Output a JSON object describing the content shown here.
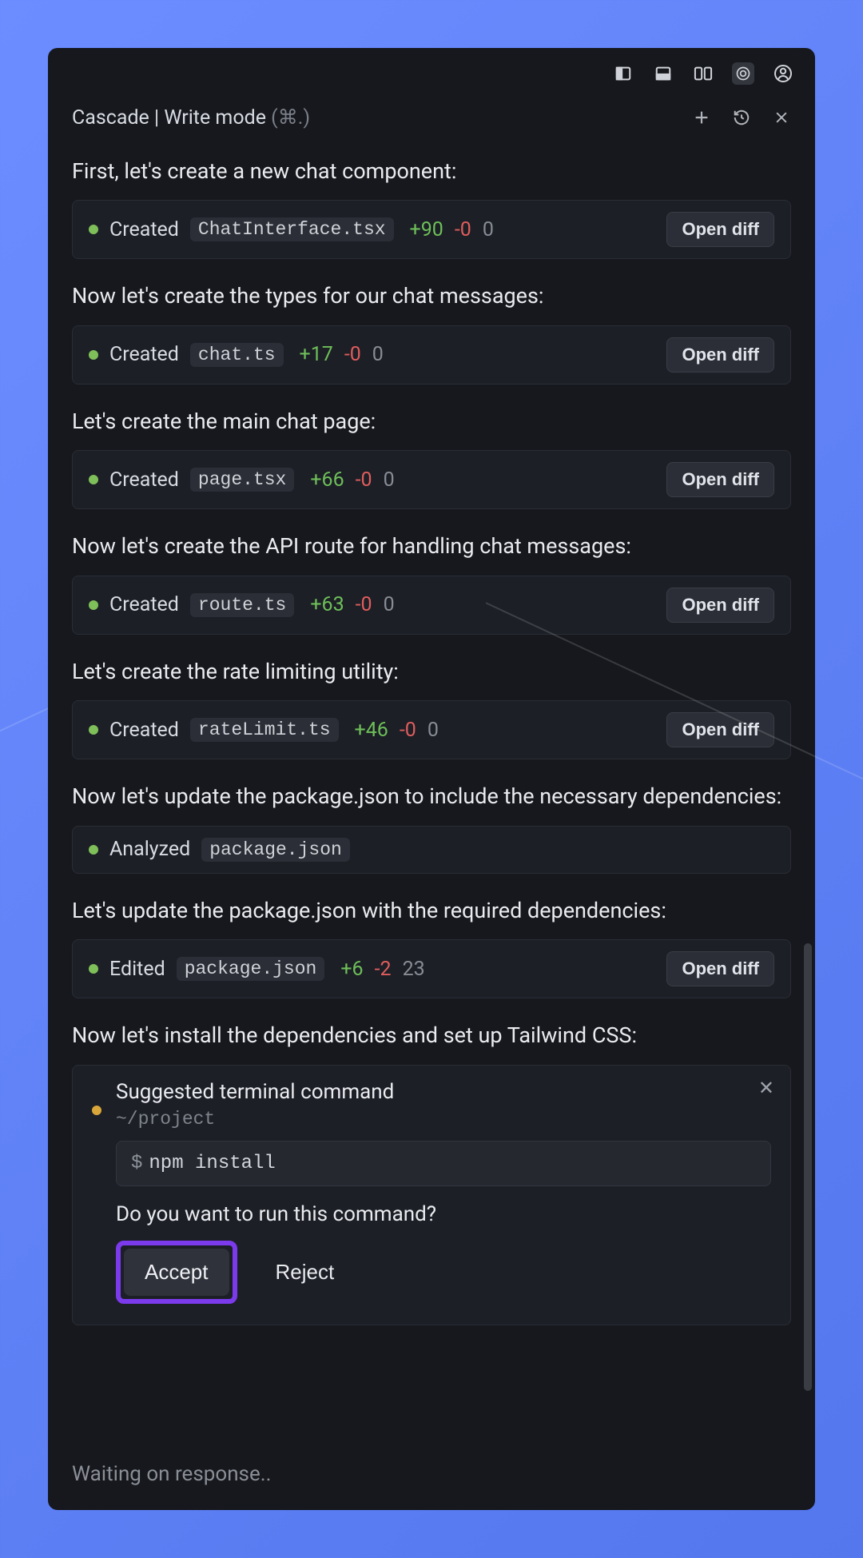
{
  "toolbar_icons": [
    "panel-left-icon",
    "panel-bottom-icon",
    "panel-split-icon",
    "windsurf-logo-icon",
    "account-icon"
  ],
  "header": {
    "title": "Cascade | Write mode",
    "shortcut": "(⌘.)",
    "icons": [
      "plus-icon",
      "history-icon",
      "close-icon"
    ]
  },
  "colors": {
    "add": "#6ebf59",
    "del": "#e05d5d",
    "neutral": "#888c94",
    "highlight": "#7c3aed"
  },
  "steps": [
    {
      "text": "First, let's create a new chat component:",
      "card": {
        "action": "Created",
        "file": "ChatInterface.tsx",
        "adds": "+90",
        "dels": "-0",
        "neutral": "0",
        "open": "Open diff"
      }
    },
    {
      "text": "Now let's create the types for our chat messages:",
      "card": {
        "action": "Created",
        "file": "chat.ts",
        "adds": "+17",
        "dels": "-0",
        "neutral": "0",
        "open": "Open diff"
      }
    },
    {
      "text": "Let's create the main chat page:",
      "card": {
        "action": "Created",
        "file": "page.tsx",
        "adds": "+66",
        "dels": "-0",
        "neutral": "0",
        "open": "Open diff"
      }
    },
    {
      "text": "Now let's create the API route for handling chat messages:",
      "card": {
        "action": "Created",
        "file": "route.ts",
        "adds": "+63",
        "dels": "-0",
        "neutral": "0",
        "open": "Open diff"
      }
    },
    {
      "text": "Let's create the rate limiting utility:",
      "card": {
        "action": "Created",
        "file": "rateLimit.ts",
        "adds": "+46",
        "dels": "-0",
        "neutral": "0",
        "open": "Open diff"
      }
    },
    {
      "text": "Now let's update the package.json to include the necessary dependencies:",
      "card": {
        "action": "Analyzed",
        "file": "package.json"
      }
    },
    {
      "text": "Let's update the package.json with the required dependencies:",
      "card": {
        "action": "Edited",
        "file": "package.json",
        "adds": "+6",
        "dels": "-2",
        "neutral": "23",
        "open": "Open diff"
      }
    },
    {
      "text": "Now let's install the dependencies and set up Tailwind CSS:"
    }
  ],
  "terminal": {
    "title": "Suggested terminal command",
    "path": "~/project",
    "prompt": "$",
    "command": "npm install",
    "question": "Do you want to run this command?",
    "accept": "Accept",
    "reject": "Reject"
  },
  "footer": "Waiting on response.."
}
